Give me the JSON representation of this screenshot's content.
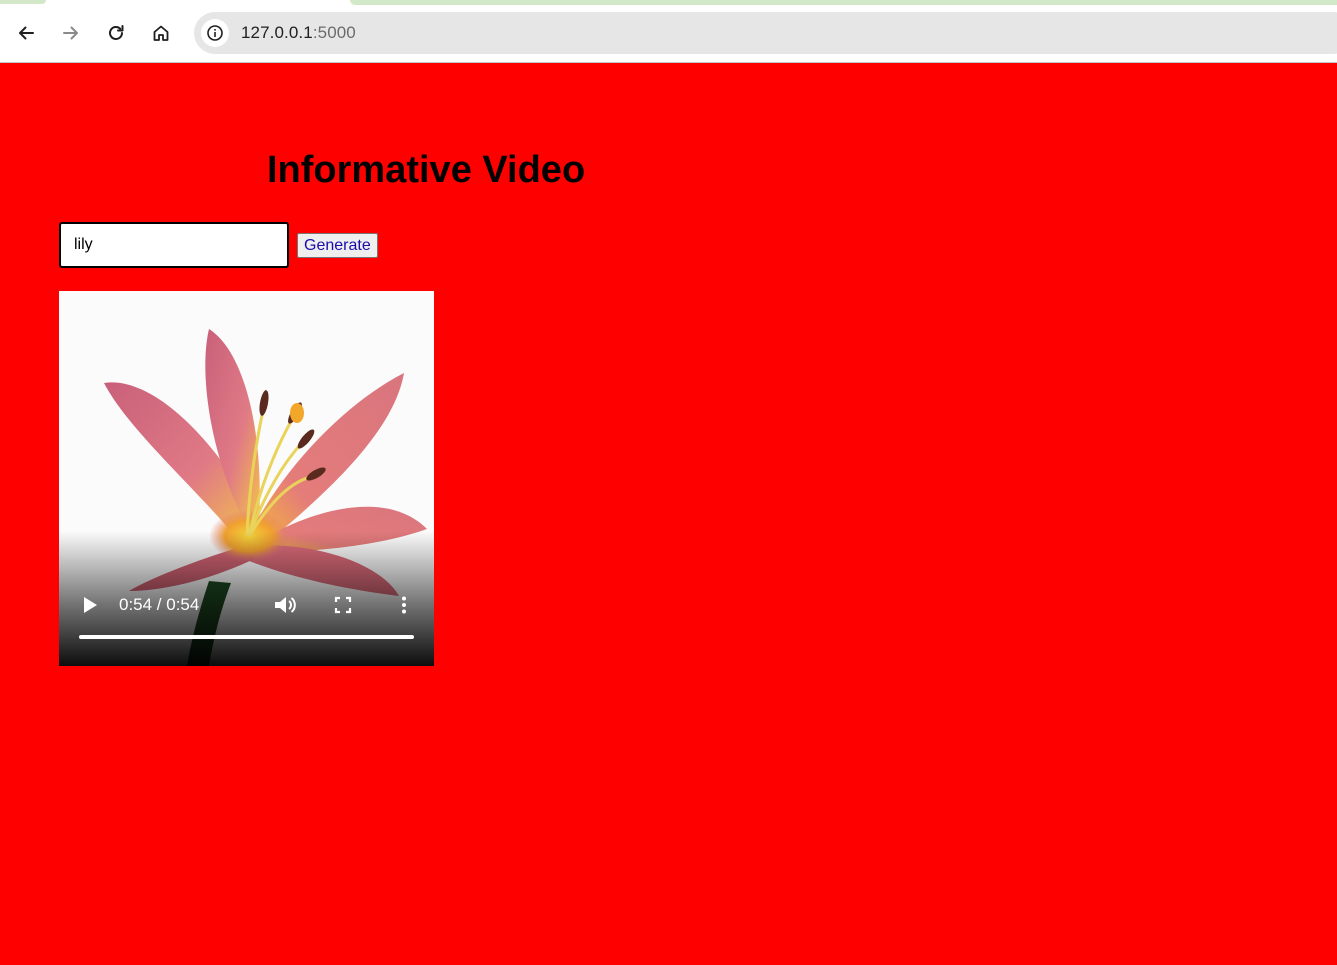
{
  "browser": {
    "url_host": "127.0.0.1",
    "url_port": ":5000"
  },
  "page": {
    "title": "Informative Video",
    "topic_input": {
      "value": "lily",
      "placeholder": ""
    },
    "generate_label": "Generate",
    "background_color": "#ff0000"
  },
  "video": {
    "subject": "pink lily flower",
    "time_display": "0:54 / 0:54",
    "progress": 1.0
  },
  "icons": [
    "back-arrow-icon",
    "forward-arrow-icon",
    "reload-icon",
    "home-icon",
    "site-info-icon",
    "play-icon",
    "volume-icon",
    "fullscreen-icon",
    "more-vert-icon"
  ]
}
